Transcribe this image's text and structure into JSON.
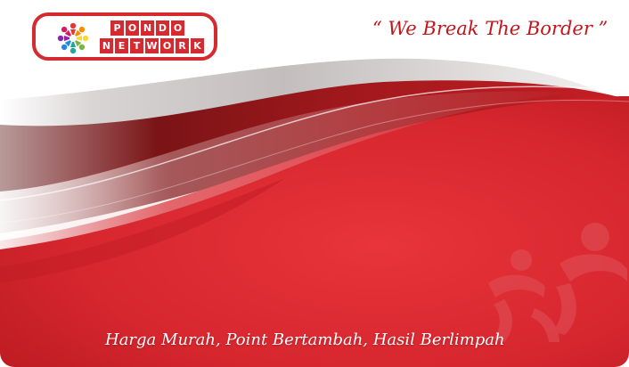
{
  "brand": {
    "logo_line1": "PONDO",
    "logo_line2": "NETWORK",
    "logo_icon": "people-circle-icon",
    "brand_red": "#d42a30"
  },
  "card": {
    "tagline": "“ We  Break  The  Border ”",
    "slogan": "Harga Murah, Point Bertambah, Hasil Berlimpah",
    "watermark_icon": "people-watermark-icon"
  },
  "colors": {
    "background": "#ffffff",
    "red": "#d6262e",
    "dark_red": "#8e1216",
    "silver": "#c9c4c4"
  }
}
